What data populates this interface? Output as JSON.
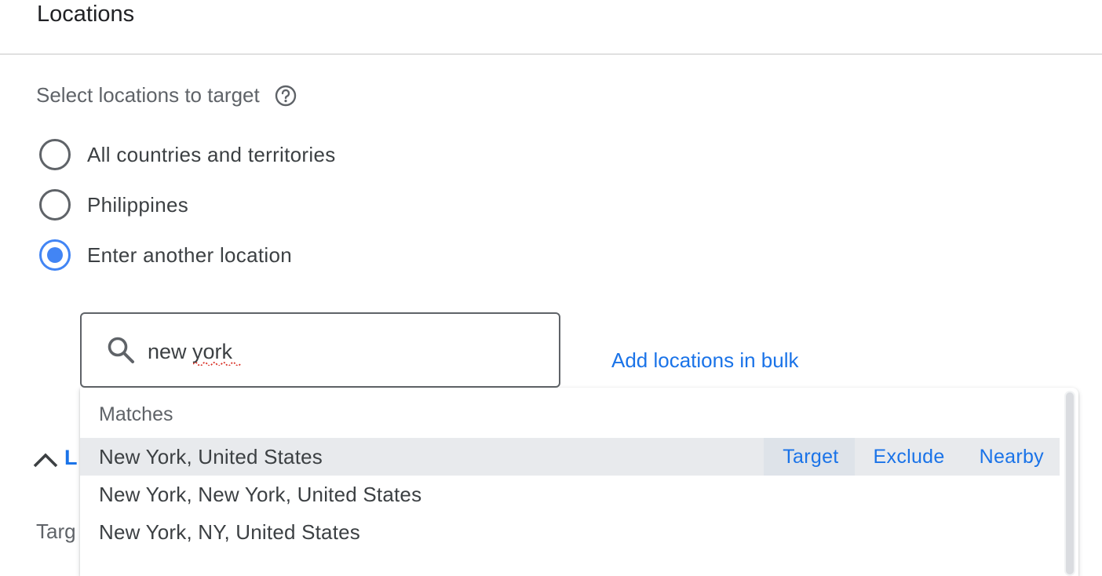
{
  "section": {
    "title": "Locations"
  },
  "targeting": {
    "prompt": "Select locations to target",
    "help_icon": "help-circle-icon",
    "options": [
      {
        "label": "All countries and territories",
        "checked": false
      },
      {
        "label": "Philippines",
        "checked": false
      },
      {
        "label": "Enter another location",
        "checked": true
      }
    ]
  },
  "search": {
    "icon": "search-icon",
    "value": "new york",
    "placeholder": ""
  },
  "bulk_link": "Add locations in bulk",
  "background": {
    "partial_link": "L",
    "partial_label": "Targ"
  },
  "dropdown": {
    "header": "Matches",
    "items": [
      {
        "label": "New York, United States",
        "highlighted": true
      },
      {
        "label": "New York, New York, United States",
        "highlighted": false
      },
      {
        "label": "New York, NY, United States",
        "highlighted": false
      }
    ],
    "actions": [
      "Target",
      "Exclude",
      "Nearby"
    ]
  },
  "colors": {
    "accent": "#1a73e8",
    "radio_selected": "#4285f4",
    "highlight_row": "#e8eaed",
    "spell_underline": "#d93025"
  }
}
